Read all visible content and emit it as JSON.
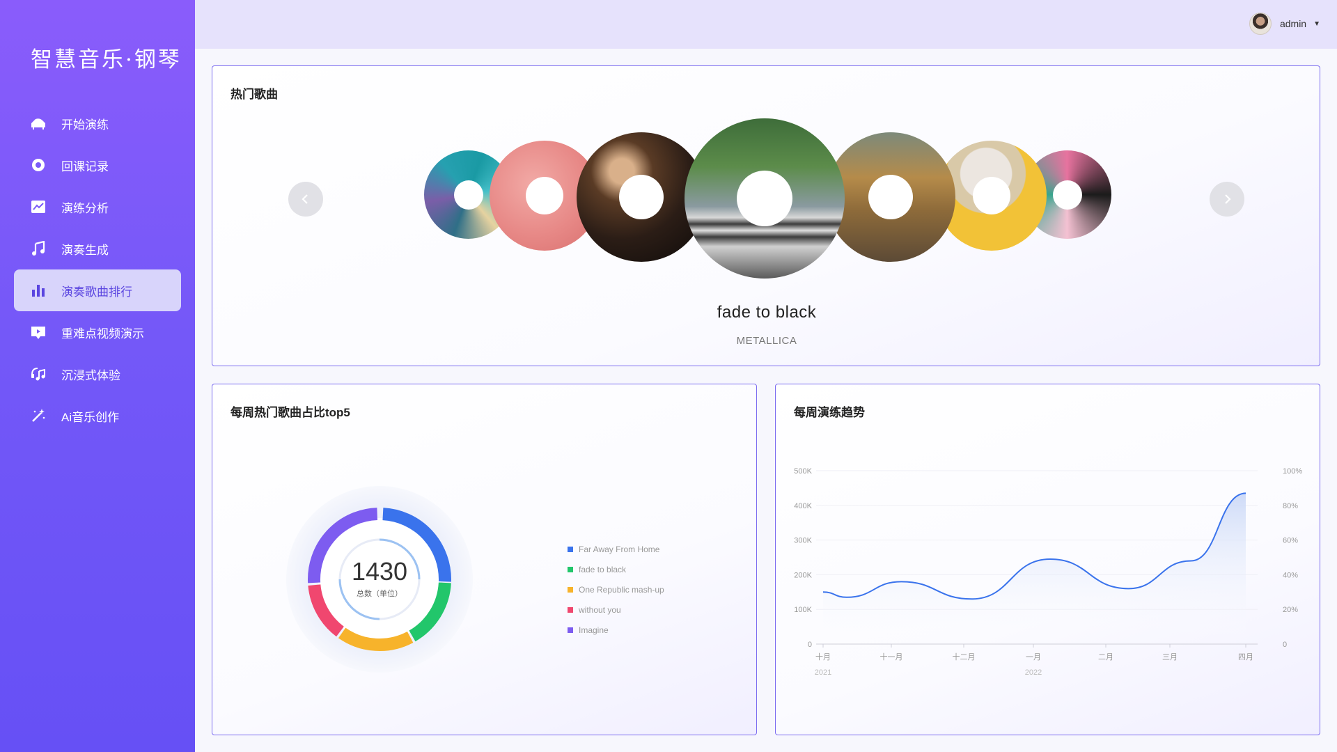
{
  "app": {
    "brand": "智慧音乐·钢琴"
  },
  "sidebar": {
    "items": [
      {
        "label": "开始演练",
        "icon": "piano-icon"
      },
      {
        "label": "回课记录",
        "icon": "record-circle-icon"
      },
      {
        "label": "演练分析",
        "icon": "trend-chart-icon"
      },
      {
        "label": "演奏生成",
        "icon": "music-note-icon"
      },
      {
        "label": "演奏歌曲排行",
        "icon": "bar-chart-icon",
        "active": true
      },
      {
        "label": "重难点视频演示",
        "icon": "video-icon"
      },
      {
        "label": "沉浸式体验",
        "icon": "headphone-music-icon"
      },
      {
        "label": "Ai音乐创作",
        "icon": "magic-wand-icon"
      }
    ]
  },
  "topbar": {
    "username": "admin"
  },
  "hot_songs": {
    "title": "热门歌曲",
    "current_title": "fade to black",
    "current_artist": "METALLICA"
  },
  "top5": {
    "title": "每周热门歌曲占比top5",
    "total": "1430",
    "total_label": "总数（单位）",
    "legend": [
      {
        "name": "Far Away From Home",
        "color": "#3a73ec"
      },
      {
        "name": "fade to black",
        "color": "#22c66b"
      },
      {
        "name": "One Republic mash-up",
        "color": "#f7b32b"
      },
      {
        "name": "without you",
        "color": "#f0476f"
      },
      {
        "name": "Imagine",
        "color": "#7d5cf0"
      }
    ]
  },
  "trend": {
    "title": "每周演练趋势",
    "chart_data": {
      "type": "area",
      "x_labels": [
        "十月",
        "十一月",
        "十二月",
        "一月",
        "二月",
        "三月",
        "四月"
      ],
      "x_sublabels": [
        "2021",
        "",
        "",
        "2022",
        "",
        "",
        ""
      ],
      "y_left_ticks": [
        "0",
        "100K",
        "200K",
        "300K",
        "400K",
        "500K"
      ],
      "y_right_ticks": [
        "0",
        "20%",
        "40%",
        "60%",
        "80%",
        "100%"
      ],
      "ylim": [
        0,
        500000
      ],
      "series": [
        {
          "x": [
            0,
            0.3,
            1.0,
            1.9,
            2.9,
            3.9,
            4.7,
            5.4
          ],
          "values": [
            150000,
            135000,
            180000,
            130000,
            245000,
            160000,
            240000,
            435000
          ]
        }
      ],
      "color": "#3a73ec"
    }
  }
}
